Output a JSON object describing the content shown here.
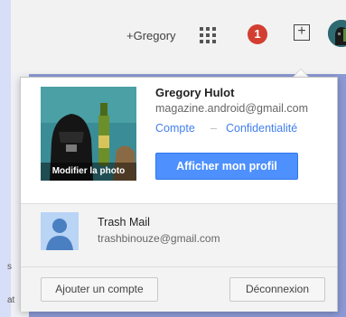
{
  "topbar": {
    "plus_name": "+Gregory",
    "notification_count": "1",
    "icons": [
      "apps-icon",
      "notification-badge",
      "share-icon",
      "account-avatar"
    ]
  },
  "profile": {
    "name": "Gregory Hulot",
    "email": "magazine.android@gmail.com",
    "link_account": "Compte",
    "link_separator": "–",
    "link_privacy": "Confidentialité",
    "photo_caption": "Modifier la photo",
    "view_profile_button": "Afficher mon profil"
  },
  "other_account": {
    "name": "Trash Mail",
    "email": "trashbinouze@gmail.com"
  },
  "footer": {
    "add_account_button": "Ajouter un compte",
    "logout_button": "Déconnexion"
  },
  "background_partial_text": {
    "line1": "s",
    "line2": "at"
  },
  "colors": {
    "accent_blue": "#4d90fe",
    "link_blue": "#427fed",
    "notification_red": "#d23f31",
    "outer_background": "#8b9ad6"
  }
}
